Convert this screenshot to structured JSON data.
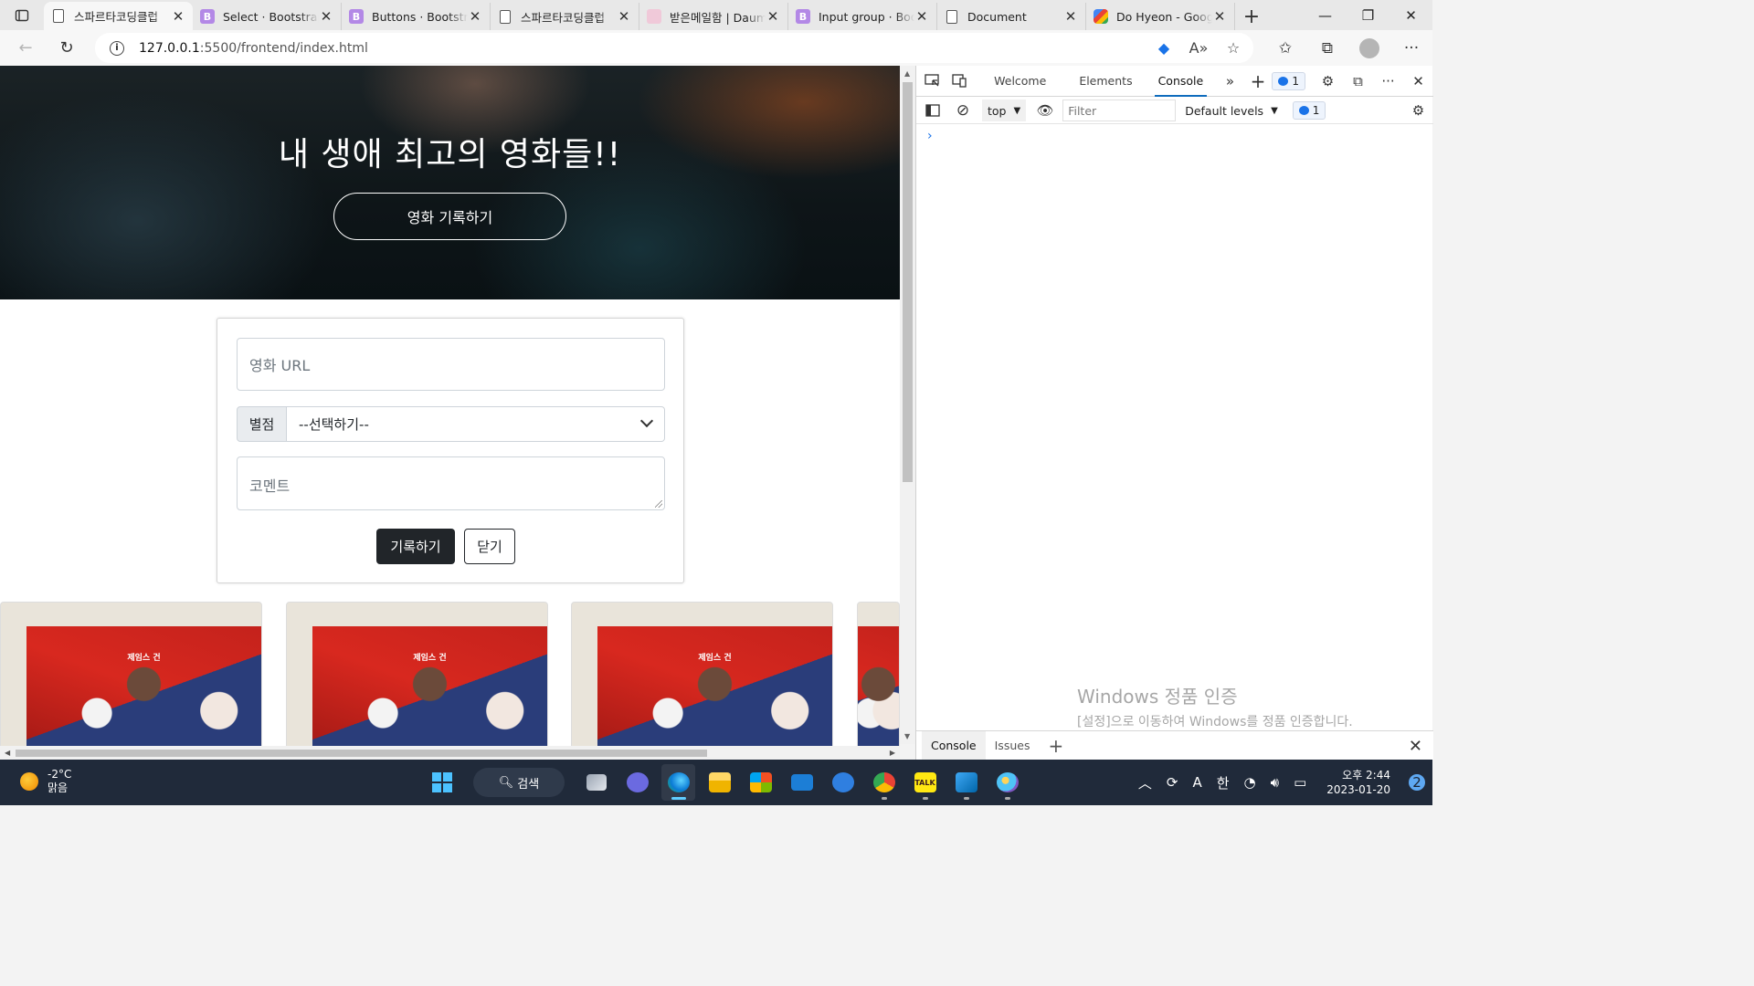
{
  "browser": {
    "tabs": [
      {
        "title": "스파르타코딩클럽",
        "favicon": "doc-icon",
        "active": true
      },
      {
        "title": "Select · Bootstrap",
        "favicon": "bootstrap-icon"
      },
      {
        "title": "Buttons · Bootstrap",
        "favicon": "bootstrap-icon"
      },
      {
        "title": "스파르타코딩클럽",
        "favicon": "doc-icon"
      },
      {
        "title": "받은메일함 | Daum",
        "favicon": "mail-icon"
      },
      {
        "title": "Input group · Bootstrap",
        "favicon": "bootstrap-icon"
      },
      {
        "title": "Document",
        "favicon": "doc-icon"
      },
      {
        "title": "Do Hyeon - Google",
        "favicon": "google-icon"
      }
    ],
    "bootstrap_glyph": "B",
    "url_host": "127.0.0.1",
    "url_path": ":5500/frontend/index.html"
  },
  "page": {
    "hero_title": "내 생애 최고의 영화들!!",
    "hero_button": "영화 기록하기",
    "form": {
      "url_placeholder": "영화 URL",
      "rating_label": "별점",
      "rating_selected": "--선택하기--",
      "comment_placeholder": "코멘트",
      "save_button": "기록하기",
      "close_button": "닫기"
    },
    "movie_cards": [
      {
        "poster_text": "제임스 건"
      },
      {
        "poster_text": "제임스 건"
      },
      {
        "poster_text": "제임스 건"
      },
      {
        "poster_text": ""
      }
    ]
  },
  "devtools": {
    "tabs": [
      "Welcome",
      "Elements",
      "Console"
    ],
    "active_tab": "Console",
    "issue_count": "1",
    "context": "top",
    "filter_placeholder": "Filter",
    "levels": "Default levels",
    "message_count": "1",
    "drawer_tabs": [
      "Console",
      "Issues"
    ],
    "watermark_line1": "Windows 정품 인증",
    "watermark_line2": "[설정]으로 이동하여 Windows를 정품 인증합니다."
  },
  "taskbar": {
    "temperature": "-2°C",
    "weather": "맑음",
    "search_label": "검색",
    "ime": "한",
    "ime_mode": "A",
    "time": "오후 2:44",
    "date": "2023-01-20",
    "notifications": "2",
    "kakaotalk_label": "TALK"
  },
  "colors": {
    "accent": "#0f6cbd",
    "dark_button": "#212529",
    "taskbar": "#202a3a"
  }
}
